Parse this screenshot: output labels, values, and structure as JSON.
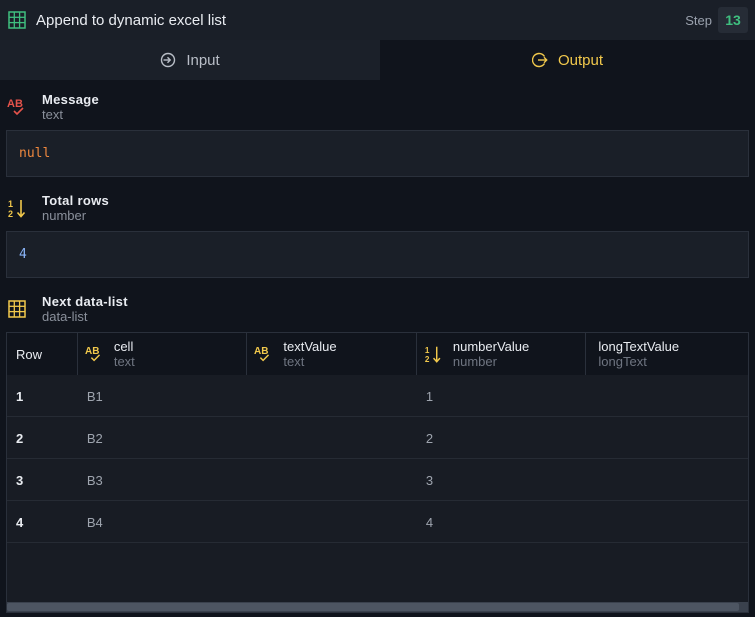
{
  "header": {
    "title": "Append to dynamic excel list",
    "step_label": "Step",
    "step_number": "13"
  },
  "tabs": [
    {
      "label": "Input",
      "icon": "login-arrow-icon"
    },
    {
      "label": "Output",
      "icon": "logout-arrow-icon",
      "active": true
    }
  ],
  "fields": [
    {
      "title": "Message",
      "type": "text",
      "icon": "text-ab-icon",
      "value": "null",
      "value_color": "#f0883e"
    },
    {
      "title": "Total rows",
      "type": "number",
      "icon": "number-sort-icon",
      "value": "4",
      "value_color": "#8ab4f8"
    },
    {
      "title": "Next data-list",
      "type": "data-list",
      "icon": "grid-icon"
    }
  ],
  "table": {
    "row_header": "Row",
    "columns": [
      {
        "name": "cell",
        "type": "text",
        "icon": "text-ab-icon"
      },
      {
        "name": "textValue",
        "type": "text",
        "icon": "text-ab-icon"
      },
      {
        "name": "numberValue",
        "type": "number",
        "icon": "number-sort-icon"
      },
      {
        "name": "longTextValue",
        "type": "longText"
      }
    ],
    "rows": [
      {
        "row": "1",
        "cell": "B1",
        "textValue": "",
        "numberValue": "1",
        "longTextValue": ""
      },
      {
        "row": "2",
        "cell": "B2",
        "textValue": "",
        "numberValue": "2",
        "longTextValue": ""
      },
      {
        "row": "3",
        "cell": "B3",
        "textValue": "",
        "numberValue": "3",
        "longTextValue": ""
      },
      {
        "row": "4",
        "cell": "B4",
        "textValue": "",
        "numberValue": "4",
        "longTextValue": ""
      }
    ]
  },
  "colors": {
    "accent": "#f2c94c",
    "grid_green": "#3fbf7f",
    "text_icon_red": "#e5534b"
  }
}
